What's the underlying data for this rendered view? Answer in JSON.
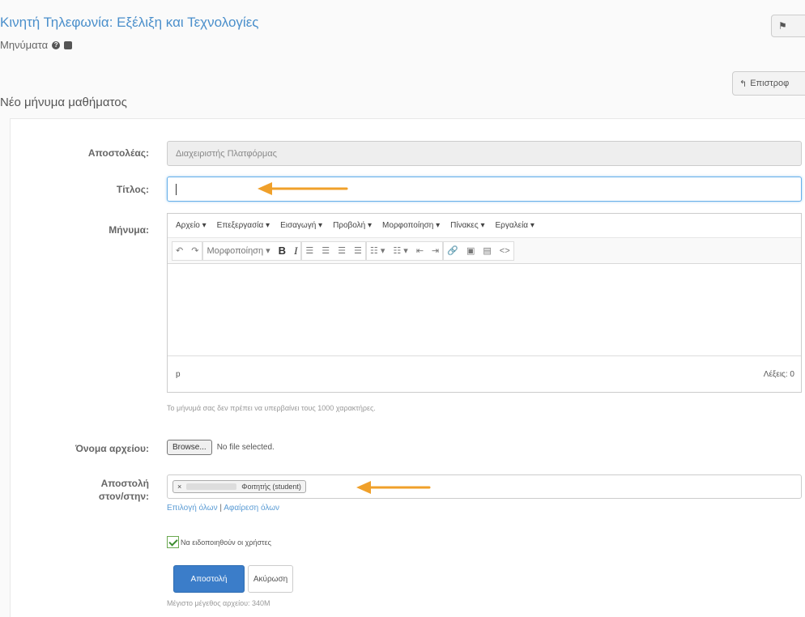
{
  "header": {
    "course_title": "Κινητή Τηλεφωνία: Εξέλιξη και Τεχνολογίες",
    "subtitle": "Μηνύματα",
    "help_icon": "help-circle-icon",
    "print_icon": "print-icon",
    "top_right_icon": "flag-icon",
    "back_button_label": "Επιστροφ"
  },
  "form": {
    "section_title": "Νέο μήνυμα μαθήματος",
    "sender_label": "Αποστολέας:",
    "sender_value": "Διαχειριστής Πλατφόρμας",
    "title_label": "Τίτλος:",
    "title_value": "",
    "message_label": "Μήνυμα:",
    "editor": {
      "menu": [
        "Αρχείο ▾",
        "Επεξεργασία ▾",
        "Εισαγωγή ▾",
        "Προβολή ▾",
        "Μορφοποίηση ▾",
        "Πίνακες ▾",
        "Εργαλεία ▾"
      ],
      "format_dropdown": "Μορφοποίηση ▾",
      "status_path": "p",
      "word_count": "Λέξεις: 0"
    },
    "message_help": "Το μήνυμά σας δεν πρέπει να υπερβαίνει τους 1000 χαρακτήρες.",
    "file_label": "Όνομα αρχείου:",
    "browse_label": "Browse...",
    "no_file": "No file selected.",
    "recipients_label_line1": "Αποστολή",
    "recipients_label_line2": "στον/στην:",
    "recipient_tag": "Φοιτητής (student)",
    "recipient_remove": "×",
    "select_all": "Επιλογή όλων",
    "link_separator": "|",
    "remove_all": "Αφαίρεση όλων",
    "notify_label": "Να ειδοποιηθούν οι χρήστες",
    "notify_checked": true,
    "send_button": "Αποστολή",
    "cancel_button": "Ακύρωση",
    "max_size": "Μέγιστο μέγεθος αρχείου: 340M"
  },
  "colors": {
    "accent": "#4a8fcb",
    "primary_button": "#3b7dc9",
    "arrow": "#f0a02a"
  }
}
